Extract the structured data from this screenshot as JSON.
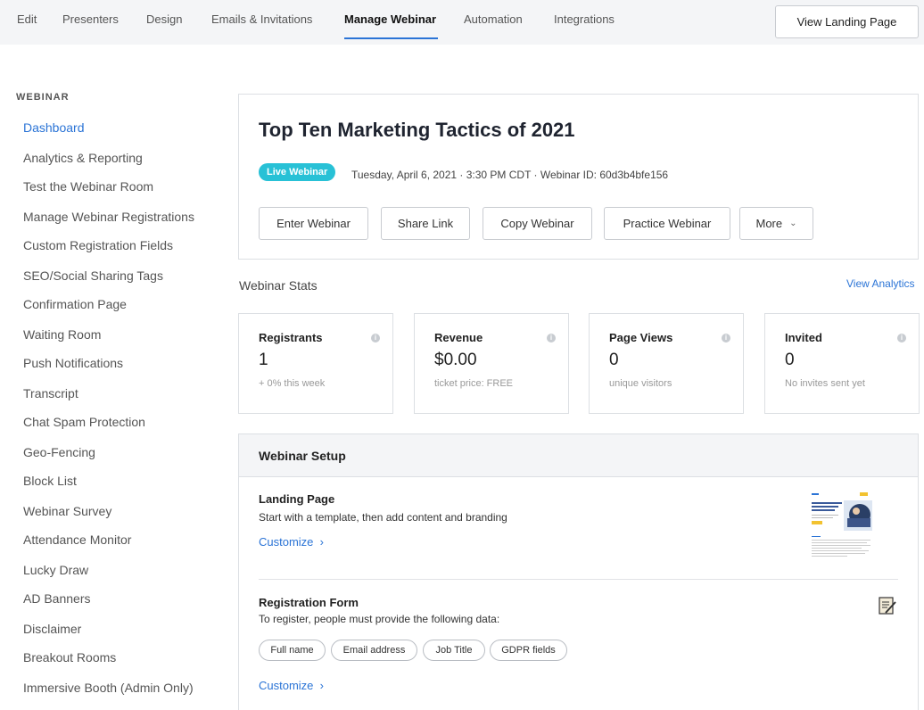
{
  "nav": {
    "tabs": [
      {
        "label": "Edit"
      },
      {
        "label": "Presenters"
      },
      {
        "label": "Design"
      },
      {
        "label": "Emails & Invitations"
      },
      {
        "label": "Manage Webinar"
      },
      {
        "label": "Automation"
      },
      {
        "label": "Integrations"
      }
    ],
    "active_tab": "Manage Webinar",
    "view_landing_label": "View Landing Page"
  },
  "sidebar": {
    "heading": "WEBINAR",
    "items": [
      {
        "label": "Dashboard"
      },
      {
        "label": "Analytics & Reporting"
      },
      {
        "label": "Test the Webinar Room"
      },
      {
        "label": "Manage Webinar Registrations"
      },
      {
        "label": "Custom Registration Fields"
      },
      {
        "label": "SEO/Social Sharing Tags"
      },
      {
        "label": "Confirmation Page"
      },
      {
        "label": "Waiting Room"
      },
      {
        "label": "Push Notifications"
      },
      {
        "label": "Transcript"
      },
      {
        "label": "Chat Spam Protection"
      },
      {
        "label": "Geo-Fencing"
      },
      {
        "label": "Block List"
      },
      {
        "label": "Webinar Survey"
      },
      {
        "label": "Attendance Monitor"
      },
      {
        "label": "Lucky Draw"
      },
      {
        "label": "AD Banners"
      },
      {
        "label": "Disclaimer"
      },
      {
        "label": "Breakout Rooms"
      },
      {
        "label": "Immersive Booth (Admin Only)"
      }
    ],
    "active_item": "Dashboard"
  },
  "webinar": {
    "title": "Top Ten Marketing Tactics of 2021",
    "badge": "Live Webinar",
    "meta": "Tuesday, April 6, 2021 · 3:30 PM CDT · Webinar ID: 60d3b4bfe156",
    "actions": {
      "enter": "Enter Webinar",
      "share": "Share Link",
      "copy": "Copy Webinar",
      "practice": "Practice Webinar",
      "more": "More"
    }
  },
  "stats": {
    "title": "Webinar Stats",
    "view_analytics": "View Analytics",
    "cards": [
      {
        "label": "Registrants",
        "value": "1",
        "sub": "+ 0% this week"
      },
      {
        "label": "Revenue",
        "value": "$0.00",
        "sub": "ticket price: FREE"
      },
      {
        "label": "Page Views",
        "value": "0",
        "sub": "unique visitors"
      },
      {
        "label": "Invited",
        "value": "0",
        "sub": "No invites sent yet"
      }
    ]
  },
  "setup": {
    "title": "Webinar Setup",
    "landing": {
      "title": "Landing Page",
      "desc": "Start with a template, then add content and branding",
      "customize": "Customize"
    },
    "registration": {
      "title": "Registration Form",
      "desc": "To register, people must provide the following data:",
      "fields": [
        "Full name",
        "Email address",
        "Job Title",
        "GDPR fields"
      ],
      "customize": "Customize"
    }
  },
  "colors": {
    "accent": "#2b74d6",
    "badge": "#28c1d6"
  }
}
